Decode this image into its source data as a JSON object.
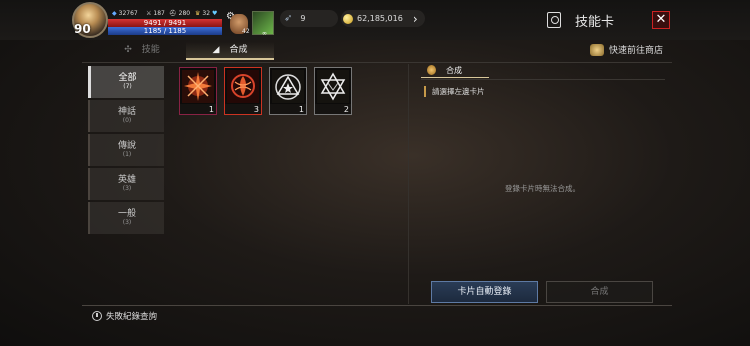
{
  "player": {
    "level": "90",
    "power": "32767",
    "stat1": "187",
    "stat2": "280",
    "stat3": "32",
    "hp": "9491 / 9491",
    "mp": "1185 / 1185",
    "potion_count": "42",
    "leaf_count": "∞"
  },
  "currency": {
    "feathers": "9",
    "gold": "62,185,016"
  },
  "header": {
    "title": "技能卡",
    "close_label": "✕"
  },
  "tabs": [
    {
      "label": "技能",
      "active": false
    },
    {
      "label": "合成",
      "active": true
    }
  ],
  "shop_link": "快速前往商店",
  "categories": [
    {
      "name": "全部",
      "count": "(7)"
    },
    {
      "name": "神話",
      "count": "(0)"
    },
    {
      "name": "傳說",
      "count": "(1)"
    },
    {
      "name": "英雄",
      "count": "(3)"
    },
    {
      "name": "一般",
      "count": "(3)"
    }
  ],
  "cards": [
    {
      "icon": "spiked-burst-icon",
      "count": "1"
    },
    {
      "icon": "flame-rune-icon",
      "count": "3"
    },
    {
      "icon": "triangle-star-icon",
      "count": "1"
    },
    {
      "icon": "hexagram-icon",
      "count": "2"
    }
  ],
  "combine_panel": {
    "tab_label": "合成",
    "hint": "請選擇左邊卡片",
    "empty_message": "登錄卡片時無法合成。",
    "auto_register_button": "卡片自動登錄",
    "combine_button": "合成"
  },
  "footer": {
    "history_link": "失敗紀錄查詢"
  },
  "colors": {
    "hp": "#d63434",
    "mp": "#3d6fd9",
    "close": "#cc2222",
    "accent": "#d8c79a"
  }
}
